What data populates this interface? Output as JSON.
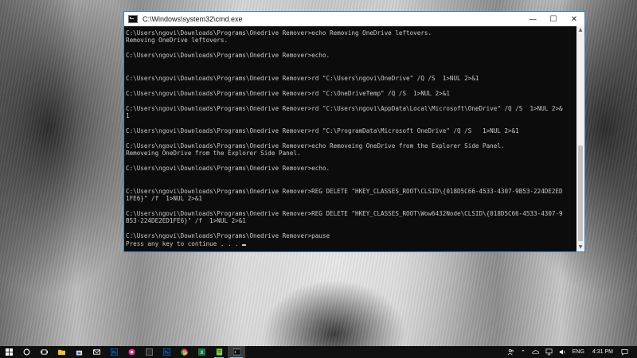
{
  "window": {
    "title": "C:\\Windows\\system32\\cmd.exe",
    "controls": {
      "minimize": "—",
      "maximize": "☐",
      "close": "✕"
    }
  },
  "console": {
    "lines": [
      "C:\\Users\\ngovi\\Downloads\\Programs\\Onedrive Remover>echo Removing OneDrive leftovers.",
      "Removing OneDrive leftovers.",
      "",
      "C:\\Users\\ngovi\\Downloads\\Programs\\Onedrive Remover>echo.",
      "",
      "",
      "C:\\Users\\ngovi\\Downloads\\Programs\\Onedrive Remover>rd \"C:\\Users\\ngovi\\OneDrive\" /Q /S  1>NUL 2>&1",
      "",
      "C:\\Users\\ngovi\\Downloads\\Programs\\Onedrive Remover>rd \"C:\\OneDriveTemp\" /Q /S  1>NUL 2>&1",
      "",
      "C:\\Users\\ngovi\\Downloads\\Programs\\Onedrive Remover>rd \"C:\\Users\\ngovi\\AppData\\Local\\Microsoft\\OneDrive\" /Q /S  1>NUL 2>&",
      "1",
      "",
      "C:\\Users\\ngovi\\Downloads\\Programs\\Onedrive Remover>rd \"C:\\ProgramData\\Microsoft OneDrive\" /Q /S   1>NUL 2>&1",
      "",
      "C:\\Users\\ngovi\\Downloads\\Programs\\Onedrive Remover>echo Removeing OneDrive from the Explorer Side Panel.",
      "Removeing OneDrive from the Explorer Side Panel.",
      "",
      "C:\\Users\\ngovi\\Downloads\\Programs\\Onedrive Remover>echo.",
      "",
      "",
      "C:\\Users\\ngovi\\Downloads\\Programs\\Onedrive Remover>REG DELETE \"HKEY_CLASSES_ROOT\\CLSID\\{018D5C66-4533-4307-9B53-224DE2ED",
      "1FE6}\" /f  1>NUL 2>&1",
      "",
      "C:\\Users\\ngovi\\Downloads\\Programs\\Onedrive Remover>REG DELETE \"HKEY_CLASSES_ROOT\\Wow6432Node\\CLSID\\{018D5C66-4533-4307-9",
      "B53-224DE2ED1FE6}\" /f  1>NUL 2>&1",
      "",
      "C:\\Users\\ngovi\\Downloads\\Programs\\Onedrive Remover>pause",
      "Press any key to continue . . . "
    ]
  },
  "taskbar": {
    "items": [
      {
        "name": "start-button-icon",
        "icon": "windows-logo"
      },
      {
        "name": "cortana-search-icon",
        "icon": "circle"
      },
      {
        "name": "task-view-icon",
        "icon": "task-view"
      },
      {
        "name": "file-explorer-icon",
        "icon": "folder"
      },
      {
        "name": "store-icon",
        "icon": "bag"
      },
      {
        "name": "mail-icon",
        "icon": "envelope"
      },
      {
        "name": "photoshop-icon",
        "icon": "ps-square"
      },
      {
        "name": "media-player-icon",
        "icon": "pink-circle"
      },
      {
        "name": "app-dark-square-icon",
        "icon": "dark-square"
      },
      {
        "name": "photoshop-alt-icon",
        "icon": "ps-square"
      },
      {
        "name": "chrome-icon",
        "icon": "chrome"
      },
      {
        "name": "excel-icon",
        "icon": "x-green"
      },
      {
        "name": "notepad-plus-icon",
        "icon": "green-doc"
      },
      {
        "name": "cmd-taskbar-icon",
        "icon": "console"
      }
    ],
    "tray": {
      "language": "ENG",
      "time": "4:31 PM"
    }
  },
  "colors": {
    "console_bg": "#0c0c0c",
    "console_text": "#c9c9c9",
    "window_border": "#3b86c8",
    "taskbar_bg": "#101010",
    "accent": "#76b9ed"
  }
}
